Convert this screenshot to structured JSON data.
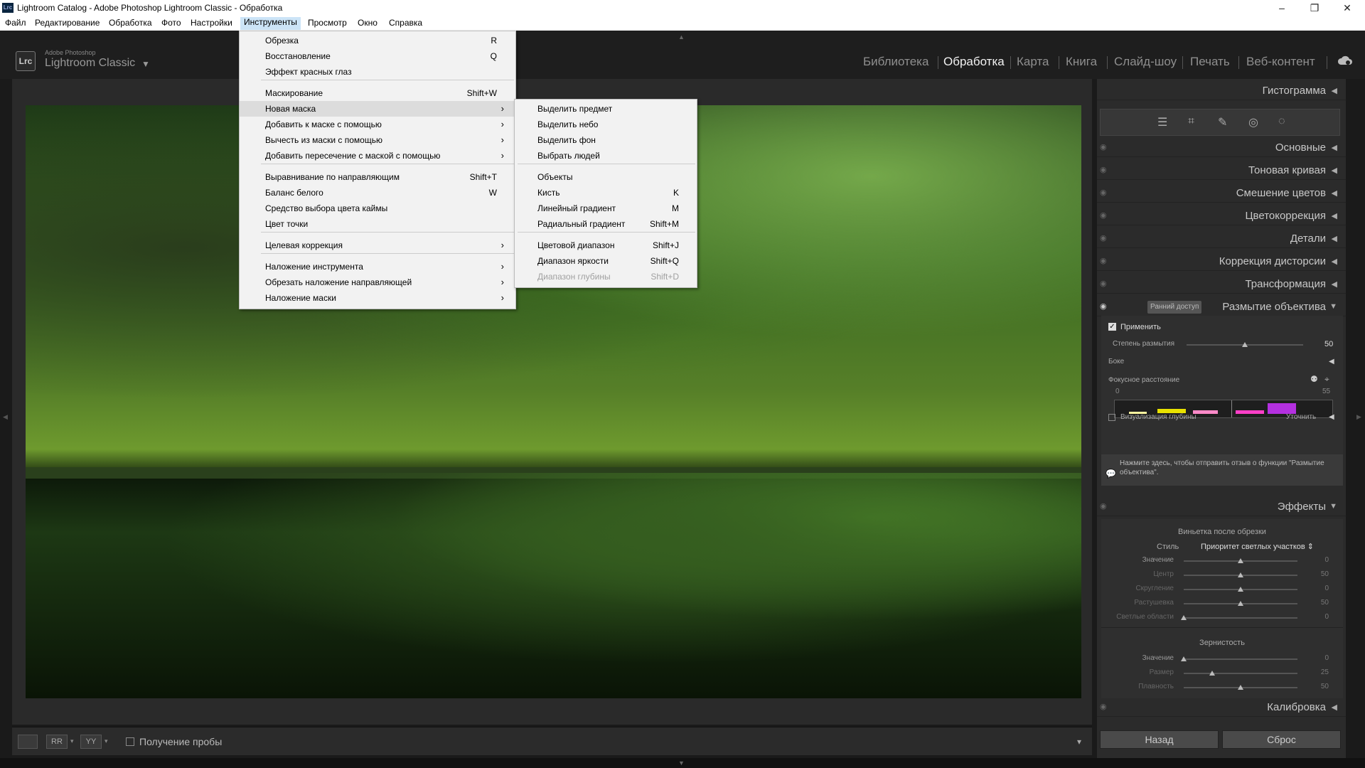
{
  "window": {
    "title": "Lightroom Catalog - Adobe Photoshop Lightroom Classic - Обработка",
    "app_icon": "Lrc",
    "minimize": "–",
    "maximize": "❐",
    "close": "✕"
  },
  "menubar": [
    "Файл",
    "Редактирование",
    "Обработка",
    "Фото",
    "Настройки",
    "Инструменты",
    "Просмотр",
    "Окно",
    "Справка"
  ],
  "brand": {
    "badge": "Lrc",
    "small": "Adobe Photoshop",
    "big": "Lightroom Classic",
    "caret": "▼"
  },
  "modules": [
    "Библиотека",
    "Обработка",
    "Карта",
    "Книга",
    "Слайд-шоу",
    "Печать",
    "Веб-контент"
  ],
  "active_module": "Обработка",
  "tools_menu": {
    "items": [
      {
        "label": "Обрезка",
        "shortcut": "R"
      },
      {
        "label": "Восстановление",
        "shortcut": "Q"
      },
      {
        "label": "Эффект красных глаз",
        "shortcut": ""
      },
      {
        "label": "Маскирование",
        "shortcut": "Shift+W"
      },
      {
        "label": "Новая маска",
        "shortcut": "›"
      },
      {
        "label": "Добавить к маске с помощью",
        "shortcut": "›"
      },
      {
        "label": "Вычесть из маски с помощью",
        "shortcut": "›"
      },
      {
        "label": "Добавить пересечение с маской с помощью",
        "shortcut": "›"
      },
      {
        "label": "Выравнивание по направляющим",
        "shortcut": "Shift+T"
      },
      {
        "label": "Баланс белого",
        "shortcut": "W"
      },
      {
        "label": "Средство выбора цвета каймы",
        "shortcut": ""
      },
      {
        "label": "Цвет точки",
        "shortcut": ""
      },
      {
        "label": "Целевая коррекция",
        "shortcut": "›"
      },
      {
        "label": "Наложение инструмента",
        "shortcut": "›"
      },
      {
        "label": "Обрезать наложение направляющей",
        "shortcut": "›"
      },
      {
        "label": "Наложение маски",
        "shortcut": "›"
      }
    ]
  },
  "new_mask_submenu": {
    "items": [
      {
        "label": "Выделить предмет",
        "shortcut": ""
      },
      {
        "label": "Выделить небо",
        "shortcut": ""
      },
      {
        "label": "Выделить фон",
        "shortcut": ""
      },
      {
        "label": "Выбрать людей",
        "shortcut": ""
      },
      {
        "label": "Объекты",
        "shortcut": ""
      },
      {
        "label": "Кисть",
        "shortcut": "K"
      },
      {
        "label": "Линейный градиент",
        "shortcut": "M"
      },
      {
        "label": "Радиальный градиент",
        "shortcut": "Shift+M"
      },
      {
        "label": "Цветовой диапазон",
        "shortcut": "Shift+J"
      },
      {
        "label": "Диапазон яркости",
        "shortcut": "Shift+Q"
      },
      {
        "label": "Диапазон глубины",
        "shortcut": "Shift+D"
      }
    ]
  },
  "right_panel": {
    "histogram": "Гистограмма",
    "sections": [
      "Основные",
      "Тоновая кривая",
      "Смешение цветов",
      "Цветокоррекция",
      "Детали",
      "Коррекция дисторсии",
      "Трансформация"
    ],
    "lens_blur": {
      "title": "Размытие объектива",
      "badge": "Ранний доступ",
      "apply": "Применить",
      "amount_label": "Степень размытия",
      "amount_value": "50",
      "amount": 0.5,
      "bokeh": "Боке",
      "focal_label": "Фокусное расстояние",
      "focal_min": "0",
      "focal_max": "55",
      "depth_vis": "Визуализация глубины",
      "refine": "Уточнить",
      "feedback": "Нажмите здесь, чтобы отправить отзыв о функции \"Размытие объектива\"."
    },
    "effects": {
      "title": "Эффекты",
      "vignette_title": "Виньетка после обрезки",
      "style_label": "Стиль",
      "style_value": "Приоритет светлых участков ⇕",
      "vignette_sliders": [
        {
          "label": "Значение",
          "value": "0",
          "pos": 0.5
        },
        {
          "label": "Центр",
          "value": "50",
          "pos": 0.5
        },
        {
          "label": "Скругление",
          "value": "0",
          "pos": 0.5
        },
        {
          "label": "Растушевка",
          "value": "50",
          "pos": 0.5
        },
        {
          "label": "Светлые области",
          "value": "0",
          "pos": 0.0
        }
      ],
      "grain_title": "Зернистость",
      "grain_sliders": [
        {
          "label": "Значение",
          "value": "0",
          "pos": 0.0
        },
        {
          "label": "Размер",
          "value": "25",
          "pos": 0.25
        },
        {
          "label": "Плавность",
          "value": "50",
          "pos": 0.5
        }
      ]
    },
    "calibration": "Калибровка",
    "back_button": "Назад",
    "reset_button": "Сброс"
  },
  "toolbar": {
    "view1": "",
    "view2": "RR",
    "view3": "YY",
    "caret": "▾",
    "soft_proof": "Получение пробы",
    "toggle": "▾"
  },
  "colors": {
    "accent": "#f2f2f2",
    "panel": "#2b2b2b",
    "menu_bg": "#f2f2f2"
  }
}
